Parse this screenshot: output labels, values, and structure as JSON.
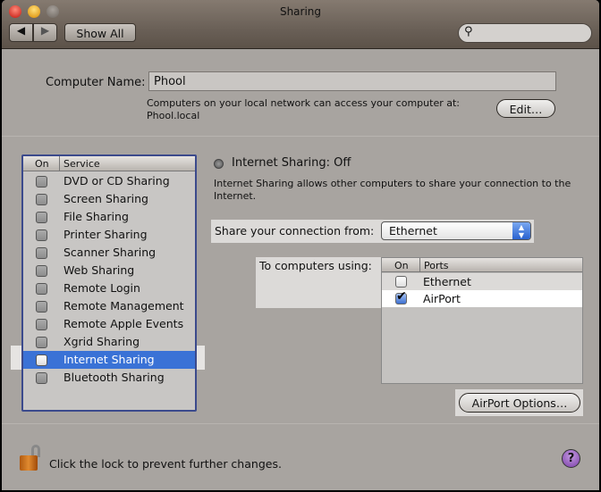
{
  "window": {
    "title": "Sharing"
  },
  "toolbar": {
    "back_icon": "back-arrow-icon",
    "forward_icon": "forward-arrow-icon",
    "show_all": "Show All",
    "search_placeholder": ""
  },
  "computer_name": {
    "label": "Computer Name:",
    "value": "Phool",
    "info": "Computers on your local network can access your computer at:",
    "address": "Phool.local",
    "edit": "Edit…"
  },
  "services": {
    "col_on": "On",
    "col_service": "Service",
    "selected": "Internet Sharing",
    "items": [
      {
        "label": "DVD or CD Sharing",
        "on": false
      },
      {
        "label": "Screen Sharing",
        "on": false
      },
      {
        "label": "File Sharing",
        "on": false
      },
      {
        "label": "Printer Sharing",
        "on": false
      },
      {
        "label": "Scanner Sharing",
        "on": false
      },
      {
        "label": "Web Sharing",
        "on": false
      },
      {
        "label": "Remote Login",
        "on": false
      },
      {
        "label": "Remote Management",
        "on": false
      },
      {
        "label": "Remote Apple Events",
        "on": false
      },
      {
        "label": "Xgrid Sharing",
        "on": false
      },
      {
        "label": "Internet Sharing",
        "on": false
      },
      {
        "label": "Bluetooth Sharing",
        "on": false
      }
    ]
  },
  "detail": {
    "status": "Internet Sharing: Off",
    "description_1": "Internet Sharing allows other computers to share your connection to the",
    "description_2": "Internet.",
    "share_from_label": "Share your connection from:",
    "share_from_value": "Ethernet",
    "to_label": "To computers using:",
    "ports": {
      "col_on": "On",
      "col_ports": "Ports",
      "items": [
        {
          "label": "Ethernet",
          "on": false
        },
        {
          "label": "AirPort",
          "on": true
        }
      ]
    },
    "airport_options": "AirPort Options…"
  },
  "footer": {
    "lock_text": "Click the lock to prevent further changes.",
    "help": "?"
  },
  "colors": {
    "selection": "#3a72d6",
    "list_border": "#3b4a8c",
    "help": "#7a3fa8"
  }
}
